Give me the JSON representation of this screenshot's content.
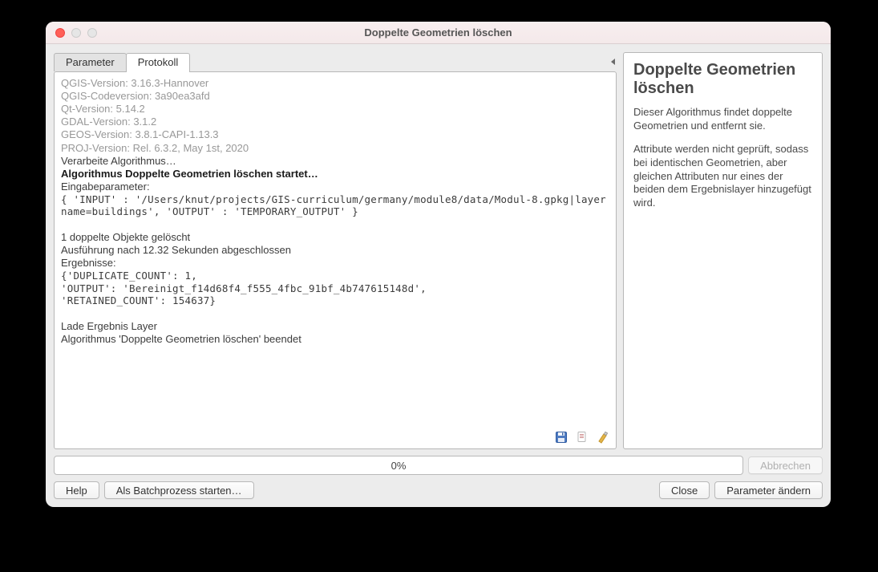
{
  "window": {
    "title": "Doppelte Geometrien löschen"
  },
  "tabs": {
    "parameter": "Parameter",
    "protokoll": "Protokoll"
  },
  "log": {
    "lines": [
      {
        "text": "QGIS-Version: 3.16.3-Hannover",
        "cls": "gray"
      },
      {
        "text": "QGIS-Codeversion: 3a90ea3afd",
        "cls": "gray"
      },
      {
        "text": "Qt-Version: 5.14.2",
        "cls": "gray"
      },
      {
        "text": "GDAL-Version: 3.1.2",
        "cls": "gray"
      },
      {
        "text": "GEOS-Version: 3.8.1-CAPI-1.13.3",
        "cls": "gray"
      },
      {
        "text": "PROJ-Version: Rel. 6.3.2, May 1st, 2020",
        "cls": "gray"
      },
      {
        "text": "Verarbeite Algorithmus…",
        "cls": ""
      },
      {
        "text": "Algorithmus Doppelte Geometrien löschen startet…",
        "cls": "bold"
      },
      {
        "text": "Eingabeparameter:",
        "cls": ""
      },
      {
        "text": "{ 'INPUT' : '/Users/knut/projects/GIS-curriculum/germany/module8/data/Modul-8.gpkg|layername=buildings', 'OUTPUT' : 'TEMPORARY_OUTPUT' }",
        "cls": "mono"
      },
      {
        "text": " ",
        "cls": ""
      },
      {
        "text": "1 doppelte Objekte gelöscht",
        "cls": ""
      },
      {
        "text": "Ausführung nach 12.32 Sekunden abgeschlossen",
        "cls": ""
      },
      {
        "text": "Ergebnisse:",
        "cls": ""
      },
      {
        "text": "{'DUPLICATE_COUNT': 1,",
        "cls": "mono"
      },
      {
        "text": "'OUTPUT': 'Bereinigt_f14d68f4_f555_4fbc_91bf_4b747615148d',",
        "cls": "mono"
      },
      {
        "text": "'RETAINED_COUNT': 154637}",
        "cls": "mono"
      },
      {
        "text": " ",
        "cls": ""
      },
      {
        "text": "Lade Ergebnis Layer",
        "cls": ""
      },
      {
        "text": "Algorithmus 'Doppelte Geometrien löschen' beendet",
        "cls": ""
      }
    ]
  },
  "help": {
    "title": "Doppelte Geometrien löschen",
    "p1": "Dieser Algorithmus findet doppelte Geometrien und entfernt sie.",
    "p2": "Attribute werden nicht geprüft, sodass bei identischen Geometrien, aber gleichen Attributen nur eines der beiden dem Ergebnislayer hinzugefügt wird."
  },
  "progress": {
    "text": "0%"
  },
  "buttons": {
    "cancel": "Abbrechen",
    "help": "Help",
    "batch": "Als Batchprozess starten…",
    "close": "Close",
    "change_params": "Parameter ändern"
  }
}
